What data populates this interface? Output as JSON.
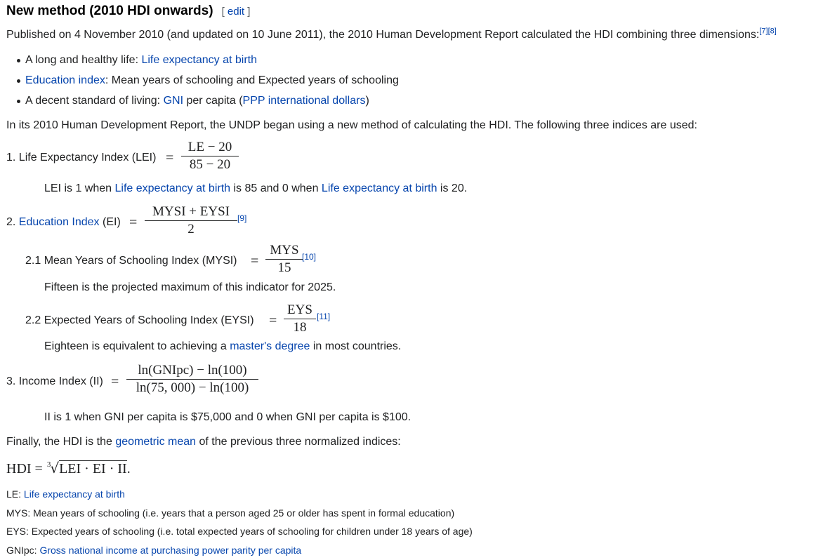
{
  "section": {
    "title": "New method (2010 HDI onwards)",
    "edit_open": "[ ",
    "edit_label": "edit",
    "edit_close": " ]"
  },
  "intro": {
    "text": "Published on 4 November 2010 (and updated on 10 June 2011), the 2010 Human Development Report calculated the HDI combining three dimensions:",
    "ref1": "[7]",
    "ref2": "[8]"
  },
  "bullets": [
    {
      "prefix": "A long and healthy life: ",
      "link": "Life expectancy at birth",
      "suffix": ""
    },
    {
      "prefix": "",
      "link": "Education index",
      "suffix": ": Mean years of schooling and Expected years of schooling"
    },
    {
      "prefix": "A decent standard of living: ",
      "link": "GNI",
      "middle": " per capita (",
      "link2": "PPP international dollars",
      "suffix": ")"
    }
  ],
  "method_intro": "In its 2010 Human Development Report, the UNDP began using a new method of calculating the HDI. The following three indices are used:",
  "lei": {
    "label": "1. Life Expectancy Index (LEI)",
    "eq": "=",
    "numerator": "LE − 20",
    "denominator": "85 − 20",
    "note_a": "LEI is 1 when ",
    "note_link1": "Life expectancy at birth",
    "note_b": " is 85 and 0 when ",
    "note_link2": "Life expectancy at birth",
    "note_c": " is 20."
  },
  "ei": {
    "label_prefix": "2. ",
    "label_link": "Education Index",
    "label_suffix": " (EI)",
    "eq": "=",
    "numerator": "MYSI + EYSI",
    "denominator": "2",
    "ref": "[9]"
  },
  "mysi": {
    "label": "2.1 Mean Years of Schooling Index (MYSI)",
    "eq": "=",
    "numerator": "MYS",
    "denominator": "15",
    "ref": "[10]",
    "note": "Fifteen is the projected maximum of this indicator for 2025."
  },
  "eysi": {
    "label": "2.2 Expected Years of Schooling Index (EYSI)",
    "eq": "=",
    "numerator": "EYS",
    "denominator": "18",
    "ref": "[11]",
    "note_a": "Eighteen is equivalent to achieving a ",
    "note_link": "master's degree",
    "note_b": " in most countries."
  },
  "ii": {
    "label": "3. Income Index (II)",
    "eq": "=",
    "numerator": "ln(GNIpc) − ln(100)",
    "denominator": "ln(75, 000) − ln(100)",
    "note": "II is 1 when GNI per capita is $75,000 and 0 when GNI per capita is $100."
  },
  "final": {
    "text_a": "Finally, the HDI is the ",
    "link": "geometric mean",
    "text_b": " of the previous three normalized indices:",
    "hdi_lhs": "HDI",
    "hdi_eq": " = ",
    "root_index": "3",
    "radical": "√",
    "radicand": "LEI · EI · II",
    "period": "."
  },
  "legend": [
    {
      "term": "LE: ",
      "link": "Life expectancy at birth",
      "text": ""
    },
    {
      "term": "MYS: ",
      "link": "",
      "text": "Mean years of schooling (i.e. years that a person aged 25 or older has spent in formal education)"
    },
    {
      "term": "EYS: ",
      "link": "",
      "text": "Expected years of schooling (i.e. total expected years of schooling for children under 18 years of age)"
    },
    {
      "term": "GNIpc: ",
      "link": "Gross national income at purchasing power parity per capita",
      "text": ""
    }
  ],
  "colors": {
    "link": "#0645ad",
    "text": "#202122"
  }
}
